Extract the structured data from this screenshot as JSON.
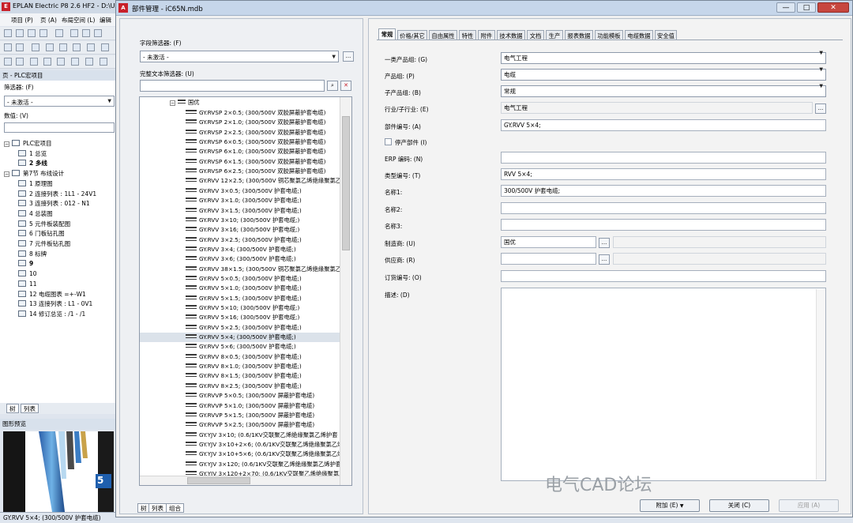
{
  "app": {
    "title": "EPLAN Electric P8 2.6 HF2 - D:\\User",
    "menu": [
      "项目 (P)",
      "页 (A)",
      "布局空间 (L)",
      "编辑"
    ],
    "pages_panel_title": "页 - PLC宏项目",
    "filter_label": "筛选器: (F)",
    "filter_value": "- 未激活 -",
    "value_label": "数值: (V)",
    "tree": [
      {
        "label": "PLC宏项目",
        "kind": "folder"
      },
      {
        "label": "1 总览",
        "kind": "page"
      },
      {
        "label": "2 多线",
        "kind": "page",
        "bold": true
      },
      {
        "label": "第7节 布线设计",
        "kind": "folder"
      },
      {
        "label": "1 原理图",
        "kind": "page"
      },
      {
        "label": "2 连接列表 : 1L1 - 24V1",
        "kind": "page"
      },
      {
        "label": "3 连接列表 : 012 - N1",
        "kind": "page"
      },
      {
        "label": "4 总装图",
        "kind": "page"
      },
      {
        "label": "5 元件板装配图",
        "kind": "page"
      },
      {
        "label": "6 门板钻孔图",
        "kind": "page"
      },
      {
        "label": "7 元件板钻孔图",
        "kind": "page"
      },
      {
        "label": "8 标牌",
        "kind": "page"
      },
      {
        "label": "9",
        "kind": "page",
        "bold": true
      },
      {
        "label": "10",
        "kind": "page"
      },
      {
        "label": "11",
        "kind": "page"
      },
      {
        "label": "12 电缆图表 =+-W1",
        "kind": "page"
      },
      {
        "label": "13 连接列表 : L1 - 0V1",
        "kind": "page"
      },
      {
        "label": "14 修订总览 : /1 - /1",
        "kind": "page"
      }
    ],
    "tabs": [
      "树",
      "列表"
    ],
    "preview_title": "图形预览",
    "preview_badge": "5",
    "status": "GY.RVV 5×4; (300/500V 护套电缆)"
  },
  "dialog": {
    "title": "部件管理 - iC65N.mdb",
    "minimize": "—",
    "maximize": "□",
    "close": "✕",
    "field_filter_label": "字段筛选器: (F)",
    "field_filter_value": "- 未激活 -",
    "text_filter_label": "完整文本筛选器: (U)",
    "text_filter_value": "",
    "group_label": "国优",
    "tree_items": [
      {
        "label": "GY.RVSP 2×0.5; (300/500V 双胶屏蔽护套电缆)"
      },
      {
        "label": "GY.RVSP 2×1.0; (300/500V 双胶屏蔽护套电缆)"
      },
      {
        "label": "GY.RVSP 2×2.5; (300/500V 双胶屏蔽护套电缆)"
      },
      {
        "label": "GY.RVSP 6×0.5; (300/500V 双胶屏蔽护套电缆)"
      },
      {
        "label": "GY.RVSP 6×1.0; (300/500V 双胶屏蔽护套电缆)"
      },
      {
        "label": "GY.RVSP 6×1.5; (300/500V 双胶屏蔽护套电缆)"
      },
      {
        "label": "GY.RVSP 6×2.5; (300/500V 双胶屏蔽护套电缆)"
      },
      {
        "label": "GY.RVV 12×2.5; (300/500V 铜芯聚氯乙烯绝缘聚氯乙"
      },
      {
        "label": "GY.RVV 3×0.5; (300/500V 护套电缆;)"
      },
      {
        "label": "GY.RVV 3×1.0; (300/500V 护套电缆;)"
      },
      {
        "label": "GY.RVV 3×1.5; (300/500V 护套电缆;)"
      },
      {
        "label": "GY.RVV 3×10; (300/500V 护套电缆;)"
      },
      {
        "label": "GY.RVV 3×16; (300/500V 护套电缆;)"
      },
      {
        "label": "GY.RVV 3×2.5; (300/500V 护套电缆;)"
      },
      {
        "label": "GY.RVV 3×4; (300/500V 护套电缆;)"
      },
      {
        "label": "GY.RVV 3×6; (300/500V 护套电缆;)"
      },
      {
        "label": "GY.RVV 38×1.5; (300/500V 铜芯聚氯乙烯绝缘聚氯乙"
      },
      {
        "label": "GY.RVV 5×0.5; (300/500V 护套电缆;)"
      },
      {
        "label": "GY.RVV 5×1.0; (300/500V 护套电缆;)"
      },
      {
        "label": "GY.RVV 5×1.5; (300/500V 护套电缆;)"
      },
      {
        "label": "GY.RVV 5×10; (300/500V 护套电缆;)"
      },
      {
        "label": "GY.RVV 5×16; (300/500V 护套电缆;)"
      },
      {
        "label": "GY.RVV 5×2.5; (300/500V 护套电缆;)"
      },
      {
        "label": "GY.RVV 5×4; (300/500V 护套电缆;)",
        "selected": true
      },
      {
        "label": "GY.RVV 5×6; (300/500V 护套电缆;)"
      },
      {
        "label": "GY.RVV 8×0.5; (300/500V 护套电缆;)"
      },
      {
        "label": "GY.RVV 8×1.0; (300/500V 护套电缆;)"
      },
      {
        "label": "GY.RVV 8×1.5; (300/500V 护套电缆;)"
      },
      {
        "label": "GY.RVV 8×2.5; (300/500V 护套电缆;)"
      },
      {
        "label": "GY.RVVP 5×0.5; (300/500V 屏蔽护套电缆)"
      },
      {
        "label": "GY.RVVP 5×1.0; (300/500V 屏蔽护套电缆)"
      },
      {
        "label": "GY.RVVP 5×1.5; (300/500V 屏蔽护套电缆)"
      },
      {
        "label": "GY.RVVP 5×2.5; (300/500V 屏蔽护套电缆)"
      },
      {
        "label": "GY.YJV 3×10; (0.6/1KV交联聚乙烯绝缘聚氯乙烯护套"
      },
      {
        "label": "GY.YJV 3×10+2×6; (0.6/1KV交联聚乙烯绝缘聚氯乙烯"
      },
      {
        "label": "GY.YJV 3×10+5×6; (0.6/1KV交联聚乙烯绝缘聚氯乙烯"
      },
      {
        "label": "GY.YJV 3×120; (0.6/1KV交联聚乙烯绝缘聚氯乙烯护套"
      },
      {
        "label": "GY.YJV 3×120+2×70; (0.6/1KV交联聚乙烯绝缘聚氯乙"
      }
    ],
    "bottom_tabs": [
      "树",
      "列表",
      "组合"
    ],
    "tabs": [
      "常规",
      "价格/其它",
      "自由属性",
      "特性",
      "附件",
      "技术数据",
      "文档",
      "生产",
      "报表数据",
      "功能模板",
      "电缆数据",
      "安全值"
    ],
    "fields": {
      "product_top_group": {
        "label": "一类产品组: (G)",
        "value": "电气工程"
      },
      "product_group": {
        "label": "产品组: (P)",
        "value": "电缆"
      },
      "sub_product_group": {
        "label": "子产品组: (B)",
        "value": "常规"
      },
      "industry": {
        "label": "行业/子行业: (E)",
        "value": "电气工程"
      },
      "part_number": {
        "label": "部件编号: (A)",
        "value": "GY.RVV 5×4;"
      },
      "discontinued": {
        "label": "停产部件 (I)"
      },
      "erp": {
        "label": "ERP 编码: (N)",
        "value": ""
      },
      "type_number": {
        "label": "类型编号: (T)",
        "value": "RVV 5×4;"
      },
      "name1": {
        "label": "名称1:",
        "value": "300/500V 护套电缆;"
      },
      "name2": {
        "label": "名称2:",
        "value": ""
      },
      "name3": {
        "label": "名称3:",
        "value": ""
      },
      "manufacturer": {
        "label": "制造商: (U)",
        "value": "国优"
      },
      "supplier": {
        "label": "供应商: (R)",
        "value": ""
      },
      "order_number": {
        "label": "订货编号: (O)",
        "value": ""
      },
      "description": {
        "label": "描述: (D)",
        "value": ""
      }
    },
    "buttons": {
      "extra": "附加 (E)",
      "close": "关闭 (C)",
      "apply": "应用 (A)"
    },
    "dots": "..."
  },
  "watermark": "电气CAD论坛"
}
